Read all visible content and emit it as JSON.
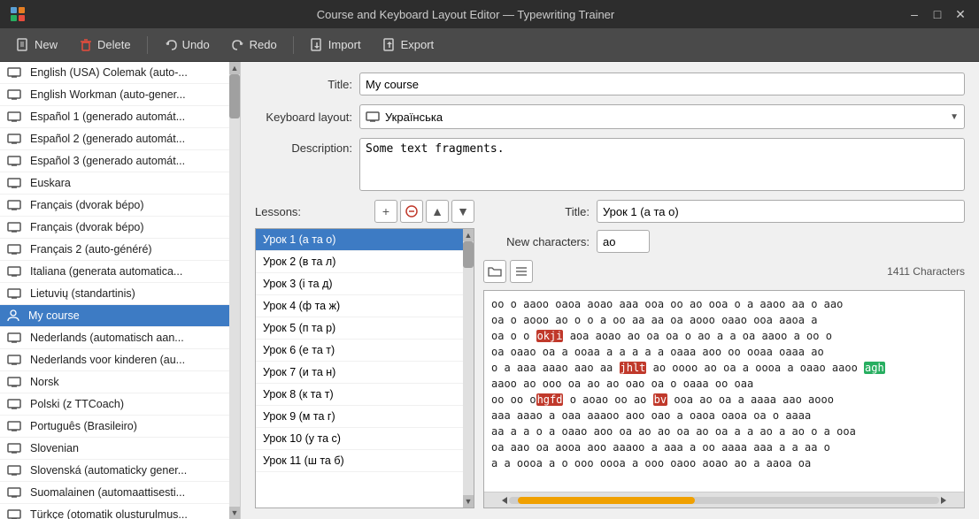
{
  "titlebar": {
    "title": "Course and Keyboard Layout Editor — Typewriting Trainer",
    "minimize_label": "–",
    "maximize_label": "□",
    "close_label": "✕"
  },
  "toolbar": {
    "new_label": "New",
    "delete_label": "Delete",
    "undo_label": "Undo",
    "redo_label": "Redo",
    "import_label": "Import",
    "export_label": "Export"
  },
  "form": {
    "title_label": "Title:",
    "title_value": "My course",
    "keyboard_label": "Keyboard layout:",
    "keyboard_value": "Українська",
    "description_label": "Description:",
    "description_value": "Some text fragments."
  },
  "lessons": {
    "label": "Lessons:",
    "items": [
      {
        "label": "Урок 1 (а та о)",
        "selected": true
      },
      {
        "label": "Урок 2 (в та л)"
      },
      {
        "label": "Урок 3 (і та д)"
      },
      {
        "label": "Урок 4 (ф та ж)"
      },
      {
        "label": "Урок 5 (п та р)"
      },
      {
        "label": "Урок 6 (е та т)"
      },
      {
        "label": "Урок 7 (и та н)"
      },
      {
        "label": "Урок 8 (к та т)"
      },
      {
        "label": "Урок 9 (м та г)"
      },
      {
        "label": "Урок 10 (у та с)"
      },
      {
        "label": "Урок 11 (ш та б)"
      }
    ],
    "detail": {
      "title_label": "Title:",
      "title_value": "Урок 1 (а та о)",
      "new_chars_label": "New characters:",
      "new_chars_value": "ao",
      "char_count": "1411 Characters",
      "text_content": "oo  o  aaoo  oaoa  aoao  aaa  ooa  oo  ao  ooa  o   a  aaoo  aa  o  aao\noa  o  aooo  ao  o  o  a  oo  aa  aa  oa  aooo  oaao  ooa  aaoa  a\noa  o  o  okji  aoa  aoao  ao  oa  oa  o  ao  a  a  oa  aaoo  a  oo  o\noa  oaao  oa  a  ooaa  a  a  a  a  a  oaaa  aoo  oo  ooaa  oaaa  ao\no  a  aaa  aaao  aao  aa  jhlt  ao  oooo  ao  oa  a  oooa  a  oaao  aaoo  agh\naaoo  ao  ooo  oa  ao  ao  oao  oa  o  oaaa  oo  oaa\noo  oo  ohgfd  o  aoao  oo  ao  bv  ooa  ao  oa  a  aaaa  aao  aooo\naaa  aaao  a  oaa  aaaoo  aoo  oao  a  oaoa  oaoa  oa  o  aaaa\naa  a  a  o  a  oaao  aoo  oa  ao  ao  oa  ao  oa  a  a  ao  a  ao  o  a  ooa\noa  aao  oa  aooa  aoo  aaaoo  a  aaa  a  oo  aaaa  aaa  a  a  aa  o\na  a  oooa  a  o  ooo  oooa  a  ooo  oaoo  aoao  ao  a  aaoa  oa"
    }
  },
  "sidebar": {
    "items": [
      {
        "label": "English (USA) Colemak (auto-...",
        "type": "monitor"
      },
      {
        "label": "English Workman (auto-gener...",
        "type": "monitor"
      },
      {
        "label": "Español 1 (generado automát...",
        "type": "monitor"
      },
      {
        "label": "Español 2 (generado automát...",
        "type": "monitor"
      },
      {
        "label": "Español 3 (generado automát...",
        "type": "monitor"
      },
      {
        "label": "Euskara",
        "type": "monitor"
      },
      {
        "label": "Français (dvorak bépo)",
        "type": "monitor"
      },
      {
        "label": "Français (dvorak bépo)",
        "type": "monitor"
      },
      {
        "label": "Français 2 (auto-généré)",
        "type": "monitor"
      },
      {
        "label": "Italiana (generata automatica...",
        "type": "monitor"
      },
      {
        "label": "Lietuvių (standartinis)",
        "type": "monitor"
      },
      {
        "label": "My course",
        "type": "person",
        "selected": true
      },
      {
        "label": "Nederlands (automatisch aan...",
        "type": "monitor"
      },
      {
        "label": "Nederlands voor kinderen (au...",
        "type": "monitor"
      },
      {
        "label": "Norsk",
        "type": "monitor"
      },
      {
        "label": "Polski (z TTCoach)",
        "type": "monitor"
      },
      {
        "label": "Português (Brasileiro)",
        "type": "monitor"
      },
      {
        "label": "Slovenian",
        "type": "monitor"
      },
      {
        "label": "Slovenská (automaticky gener...",
        "type": "monitor"
      },
      {
        "label": "Suomalainen (automaattisesti...",
        "type": "monitor"
      },
      {
        "label": "Türkçe (otomatik olusturulmus...",
        "type": "monitor"
      }
    ]
  }
}
